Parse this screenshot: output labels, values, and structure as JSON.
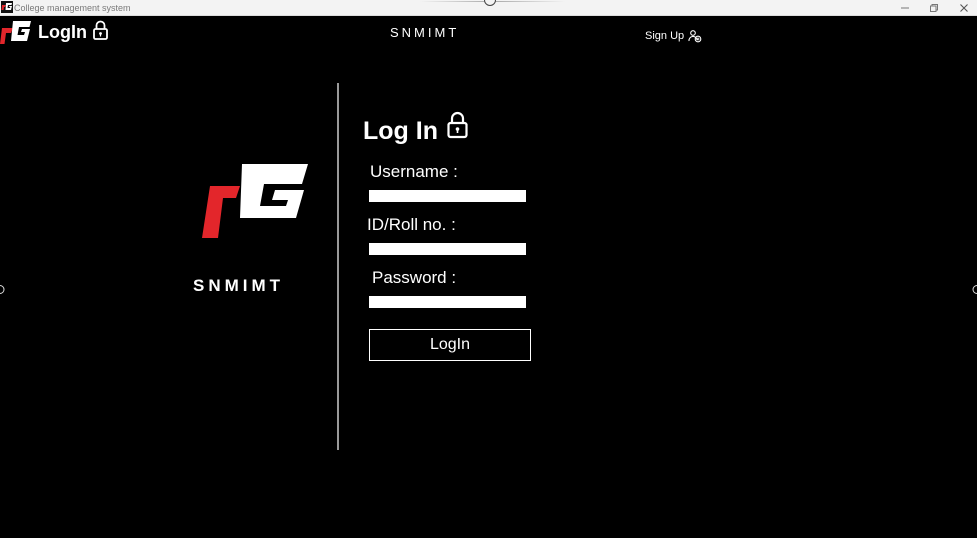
{
  "window": {
    "title": "College management system",
    "controls": {
      "minimize": "minimize-icon",
      "maximize": "restore-icon",
      "close": "close-icon"
    }
  },
  "header": {
    "title": "LogIn",
    "brand": "SNMIMT",
    "signup_label": "Sign Up"
  },
  "brand_block": {
    "name": "SNMIMT"
  },
  "form": {
    "title": "Log In",
    "fields": [
      {
        "label": "Username :",
        "value": "",
        "placeholder": ""
      },
      {
        "label": "ID/Roll no. :",
        "value": "",
        "placeholder": ""
      },
      {
        "label": "Password :",
        "value": "",
        "placeholder": ""
      }
    ],
    "submit_label": "LogIn"
  },
  "colors": {
    "background": "#000000",
    "text": "#ffffff",
    "logo_red": "#e3262b",
    "logo_white": "#ffffff",
    "divider": "#9a9a9a"
  }
}
